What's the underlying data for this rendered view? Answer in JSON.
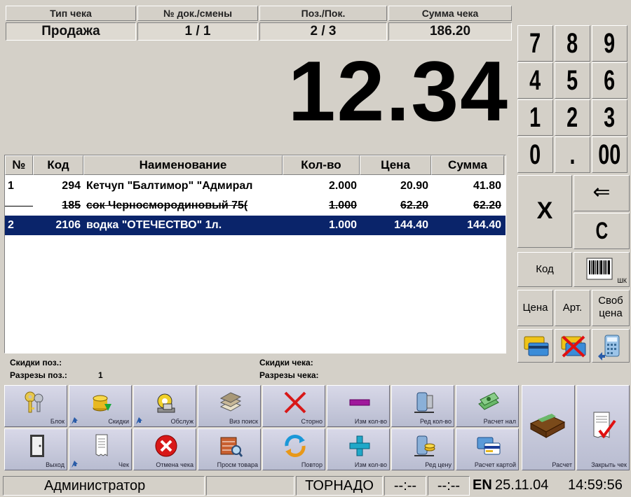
{
  "header": {
    "receipt_type_label": "Тип чека",
    "receipt_type_value": "Продажа",
    "doc_shift_label": "№ док./смены",
    "doc_shift_value": "1 / 1",
    "pos_label": "Поз./Пок.",
    "pos_value": "2 / 3",
    "total_label": "Сумма чека",
    "total_value": "186.20"
  },
  "display_amount": "12.34",
  "table": {
    "headers": [
      "№",
      "Код",
      "Наименование",
      "Кол-во",
      "Цена",
      "Сумма"
    ],
    "rows": [
      {
        "num": "1",
        "code": "294",
        "name": "Кетчуп \"Балтимор\" \"Адмирал",
        "qty": "2.000",
        "price": "20.90",
        "sum": "41.80",
        "state": "normal"
      },
      {
        "num": "",
        "code": "185",
        "name": "сок Черносмородиновый 75(",
        "qty": "1.000",
        "price": "62.20",
        "sum": "62.20",
        "state": "cancelled"
      },
      {
        "num": "2",
        "code": "2106",
        "name": "водка \"ОТЕЧЕСТВО\" 1л.",
        "qty": "1.000",
        "price": "144.40",
        "sum": "144.40",
        "state": "selected"
      }
    ]
  },
  "discounts": {
    "pos_discounts_label": "Скидки поз.:",
    "pos_cuts_label": "Разрезы поз.:",
    "pos_cuts_value": "1",
    "check_discounts_label": "Скидки чека:",
    "check_cuts_label": "Разрезы чека:"
  },
  "numpad": {
    "keys": [
      "7",
      "8",
      "9",
      "4",
      "5",
      "6",
      "1",
      "2",
      "3",
      "0",
      ".",
      "00"
    ],
    "multiply": "X",
    "backspace": "⇐",
    "clear": "C",
    "code": "Код",
    "barcode_caption": "ШК",
    "price": "Цена",
    "article": "Арт.",
    "free_price": "Своб цена"
  },
  "function_buttons": {
    "row1": [
      "Блок",
      "Скидки",
      "Обслуж",
      "Виз поиск",
      "Сторно",
      "Изм кол-во",
      "Ред кол-во",
      "Расчет нал"
    ],
    "row2": [
      "Выход",
      "Чек",
      "Отмена чека",
      "Просм товара",
      "Повтор",
      "Изм кол-во",
      "Ред цену",
      "Расчет картой"
    ],
    "pay": "Расчет",
    "close_check": "Закрыть чек"
  },
  "status_bar": {
    "user": "Администратор",
    "system": "ТОРНАДО",
    "time1": "--:--",
    "time2": "--:--",
    "lang": "EN",
    "date": "25.11.04",
    "time": "14:59:56"
  },
  "colors": {
    "window_bg": "#d4d0c8",
    "selection": "#0a246a",
    "cancel_red": "#d81818",
    "plus_cyan": "#20a8c8",
    "minus_purple": "#a0189c"
  }
}
